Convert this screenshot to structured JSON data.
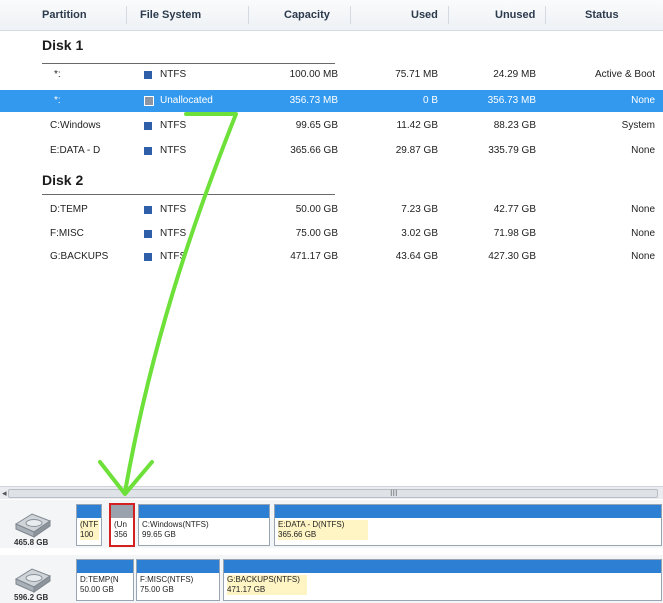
{
  "columns": [
    "Partition",
    "File System",
    "Capacity",
    "Used",
    "Unused",
    "Status"
  ],
  "disks": [
    {
      "label": "Disk 1",
      "rows": [
        {
          "partition": "*:",
          "fs": "NTFS",
          "capacity": "100.00 MB",
          "used": "75.71 MB",
          "unused": "24.29 MB",
          "status": "Active & Boot",
          "selected": false
        },
        {
          "partition": "*:",
          "fs": "Unallocated",
          "capacity": "356.73 MB",
          "used": "0 B",
          "unused": "356.73 MB",
          "status": "None",
          "selected": true
        },
        {
          "partition": "C:Windows",
          "fs": "NTFS",
          "capacity": "99.65 GB",
          "used": "11.42 GB",
          "unused": "88.23 GB",
          "status": "System",
          "selected": false
        },
        {
          "partition": "E:DATA - D",
          "fs": "NTFS",
          "capacity": "365.66 GB",
          "used": "29.87 GB",
          "unused": "335.79 GB",
          "status": "None",
          "selected": false
        }
      ]
    },
    {
      "label": "Disk 2",
      "rows": [
        {
          "partition": "D:TEMP",
          "fs": "NTFS",
          "capacity": "50.00 GB",
          "used": "7.23 GB",
          "unused": "42.77 GB",
          "status": "None",
          "selected": false
        },
        {
          "partition": "F:MISC",
          "fs": "NTFS",
          "capacity": "75.00 GB",
          "used": "3.02 GB",
          "unused": "71.98 GB",
          "status": "None",
          "selected": false
        },
        {
          "partition": "G:BACKUPS",
          "fs": "NTFS",
          "capacity": "471.17 GB",
          "used": "43.64 GB",
          "unused": "427.30 GB",
          "status": "None",
          "selected": false
        }
      ]
    }
  ],
  "diskmap": {
    "disk1": {
      "size": "465.8 GB",
      "parts": [
        {
          "line1": "(NTF",
          "line2": "100",
          "style": "yellow"
        },
        {
          "line1": "(Un",
          "line2": "356",
          "style": "selected"
        },
        {
          "line1": "C:Windows(NTFS)",
          "line2": "99.65 GB",
          "style": "normal"
        },
        {
          "line1": "E:DATA - D(NTFS)",
          "line2": "365.66 GB",
          "style": "yellow"
        }
      ]
    },
    "disk2": {
      "size": "596.2 GB",
      "parts": [
        {
          "line1": "D:TEMP(N",
          "line2": "50.00 GB",
          "style": "normal"
        },
        {
          "line1": "F:MISC(NTFS)",
          "line2": "75.00 GB",
          "style": "normal"
        },
        {
          "line1": "G:BACKUPS(NTFS)",
          "line2": "471.17 GB",
          "style": "yellow"
        }
      ]
    }
  },
  "scroll_grip": "III",
  "scroll_arrow": "◂",
  "colors": {
    "selected_row": "#3399ee",
    "partition_bar": "#2d7fd3",
    "fs_icon": "#2f5fa8",
    "annotation_arrow": "#6ee03a",
    "selection_outline": "#d32020"
  },
  "icons": [
    "hard-disk-icon",
    "ntfs-icon",
    "unallocated-icon",
    "arrow-annotation-icon"
  ]
}
